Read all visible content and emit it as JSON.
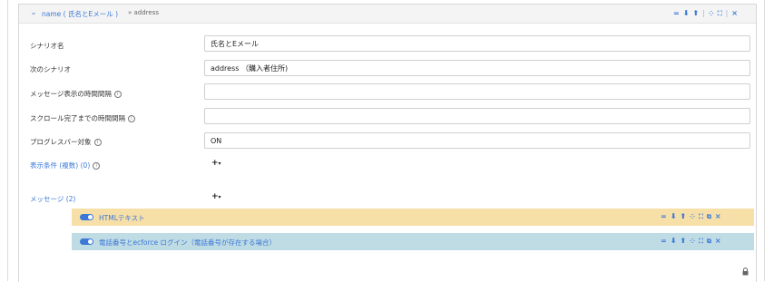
{
  "header": {
    "title": "name ( 氏名とEメール )",
    "next": "» address",
    "icons": [
      "equals-icon",
      "arrow-down-icon",
      "arrow-up-icon",
      "collapse-icon",
      "expand-icon",
      "close-icon"
    ]
  },
  "form": {
    "scenario_name_label": "シナリオ名",
    "scenario_name_value": "氏名とEメール",
    "next_scenario_label": "次のシナリオ",
    "next_scenario_value": "address （購入者住所)",
    "msg_interval_label": "メッセージ表示の時間間隔",
    "msg_interval_value": "",
    "scroll_interval_label": "スクロール完了までの時間間隔",
    "scroll_interval_value": "",
    "progress_label": "プログレスバー対象",
    "progress_value": "ON",
    "conditions_label": "表示条件 (複数) (0)",
    "info_glyph": "i"
  },
  "messages": {
    "label": "メッセージ (2)",
    "items": [
      {
        "label": "HTMLテキスト",
        "enabled": true,
        "color": "#f7dfa8"
      },
      {
        "label": "電話番号とecforce ログイン（電話番号が存在する場合）",
        "enabled": true,
        "color": "#bfdbe4"
      }
    ]
  },
  "glyphs": {
    "chevron": "⌄",
    "plus": "+",
    "caret": "▾",
    "equals": "=",
    "down": "⬇",
    "up": "⬆",
    "collapse": "⁘",
    "expand": "⛶",
    "sep": "|",
    "copy": "⧉",
    "close": "×"
  },
  "colors": {
    "accent": "#3b78d8",
    "yellow_row": "#f7dfa8",
    "blue_row": "#bfdbe4"
  }
}
